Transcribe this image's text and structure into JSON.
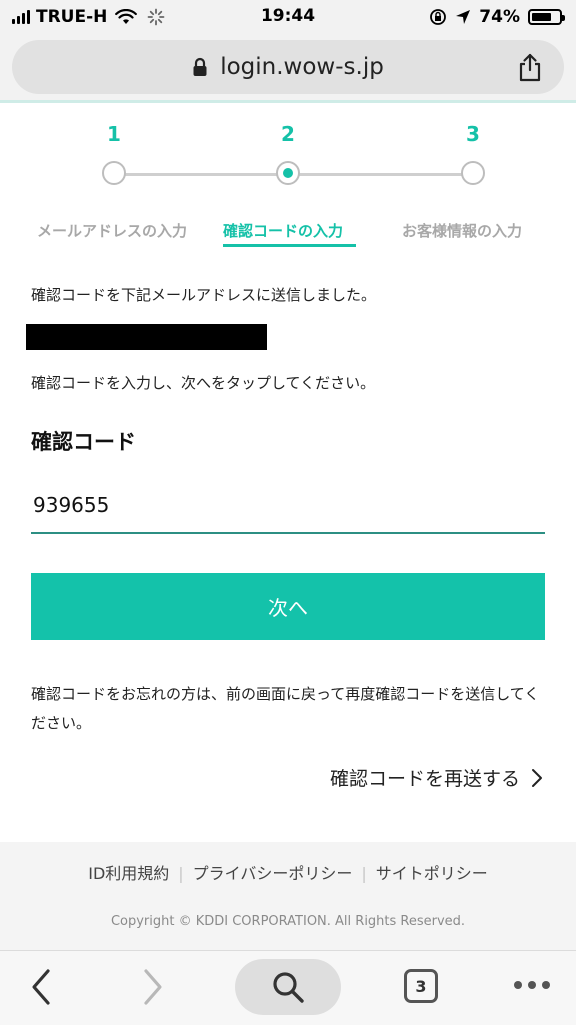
{
  "status_bar": {
    "carrier": "TRUE-H",
    "time": "19:44",
    "battery": "74%",
    "battery_level": 0.74
  },
  "browser": {
    "url": "login.wow-s.jp",
    "tab_count": "3"
  },
  "stepper": {
    "steps": [
      {
        "number": "1",
        "label": "メールアドレスの入力"
      },
      {
        "number": "2",
        "label": "確認コードの入力"
      },
      {
        "number": "3",
        "label": "お客様情報の入力"
      }
    ],
    "active_step": 2
  },
  "content": {
    "sent_message": "確認コードを下記メールアドレスに送信しました。",
    "instruction": "確認コードを入力し、次へをタップしてください。",
    "code_label": "確認コード",
    "code_value": "939655",
    "next_button": "次へ",
    "forgot_message": "確認コードをお忘れの方は、前の画面に戻って再度確認コードを送信してください。",
    "resend_link": "確認コードを再送する"
  },
  "footer": {
    "links": [
      "ID利用規約",
      "プライバシーポリシー",
      "サイトポリシー"
    ],
    "copyright": "Copyright © KDDI CORPORATION. All Rights Reserved."
  },
  "colors": {
    "accent": "#14c2aa",
    "inactive_label": "#a8a8a8",
    "footer_bg": "#f4f4f4"
  },
  "icons": {
    "signal": "cellular-signal-icon",
    "wifi": "wifi-icon",
    "loading": "loading-spinner-icon",
    "orientation_lock": "orientation-lock-icon",
    "location": "location-arrow-icon",
    "battery": "battery-icon",
    "lock": "lock-icon",
    "share": "share-icon",
    "back": "chevron-left-icon",
    "forward": "chevron-right-icon",
    "search": "search-icon",
    "more": "more-dots-icon"
  }
}
